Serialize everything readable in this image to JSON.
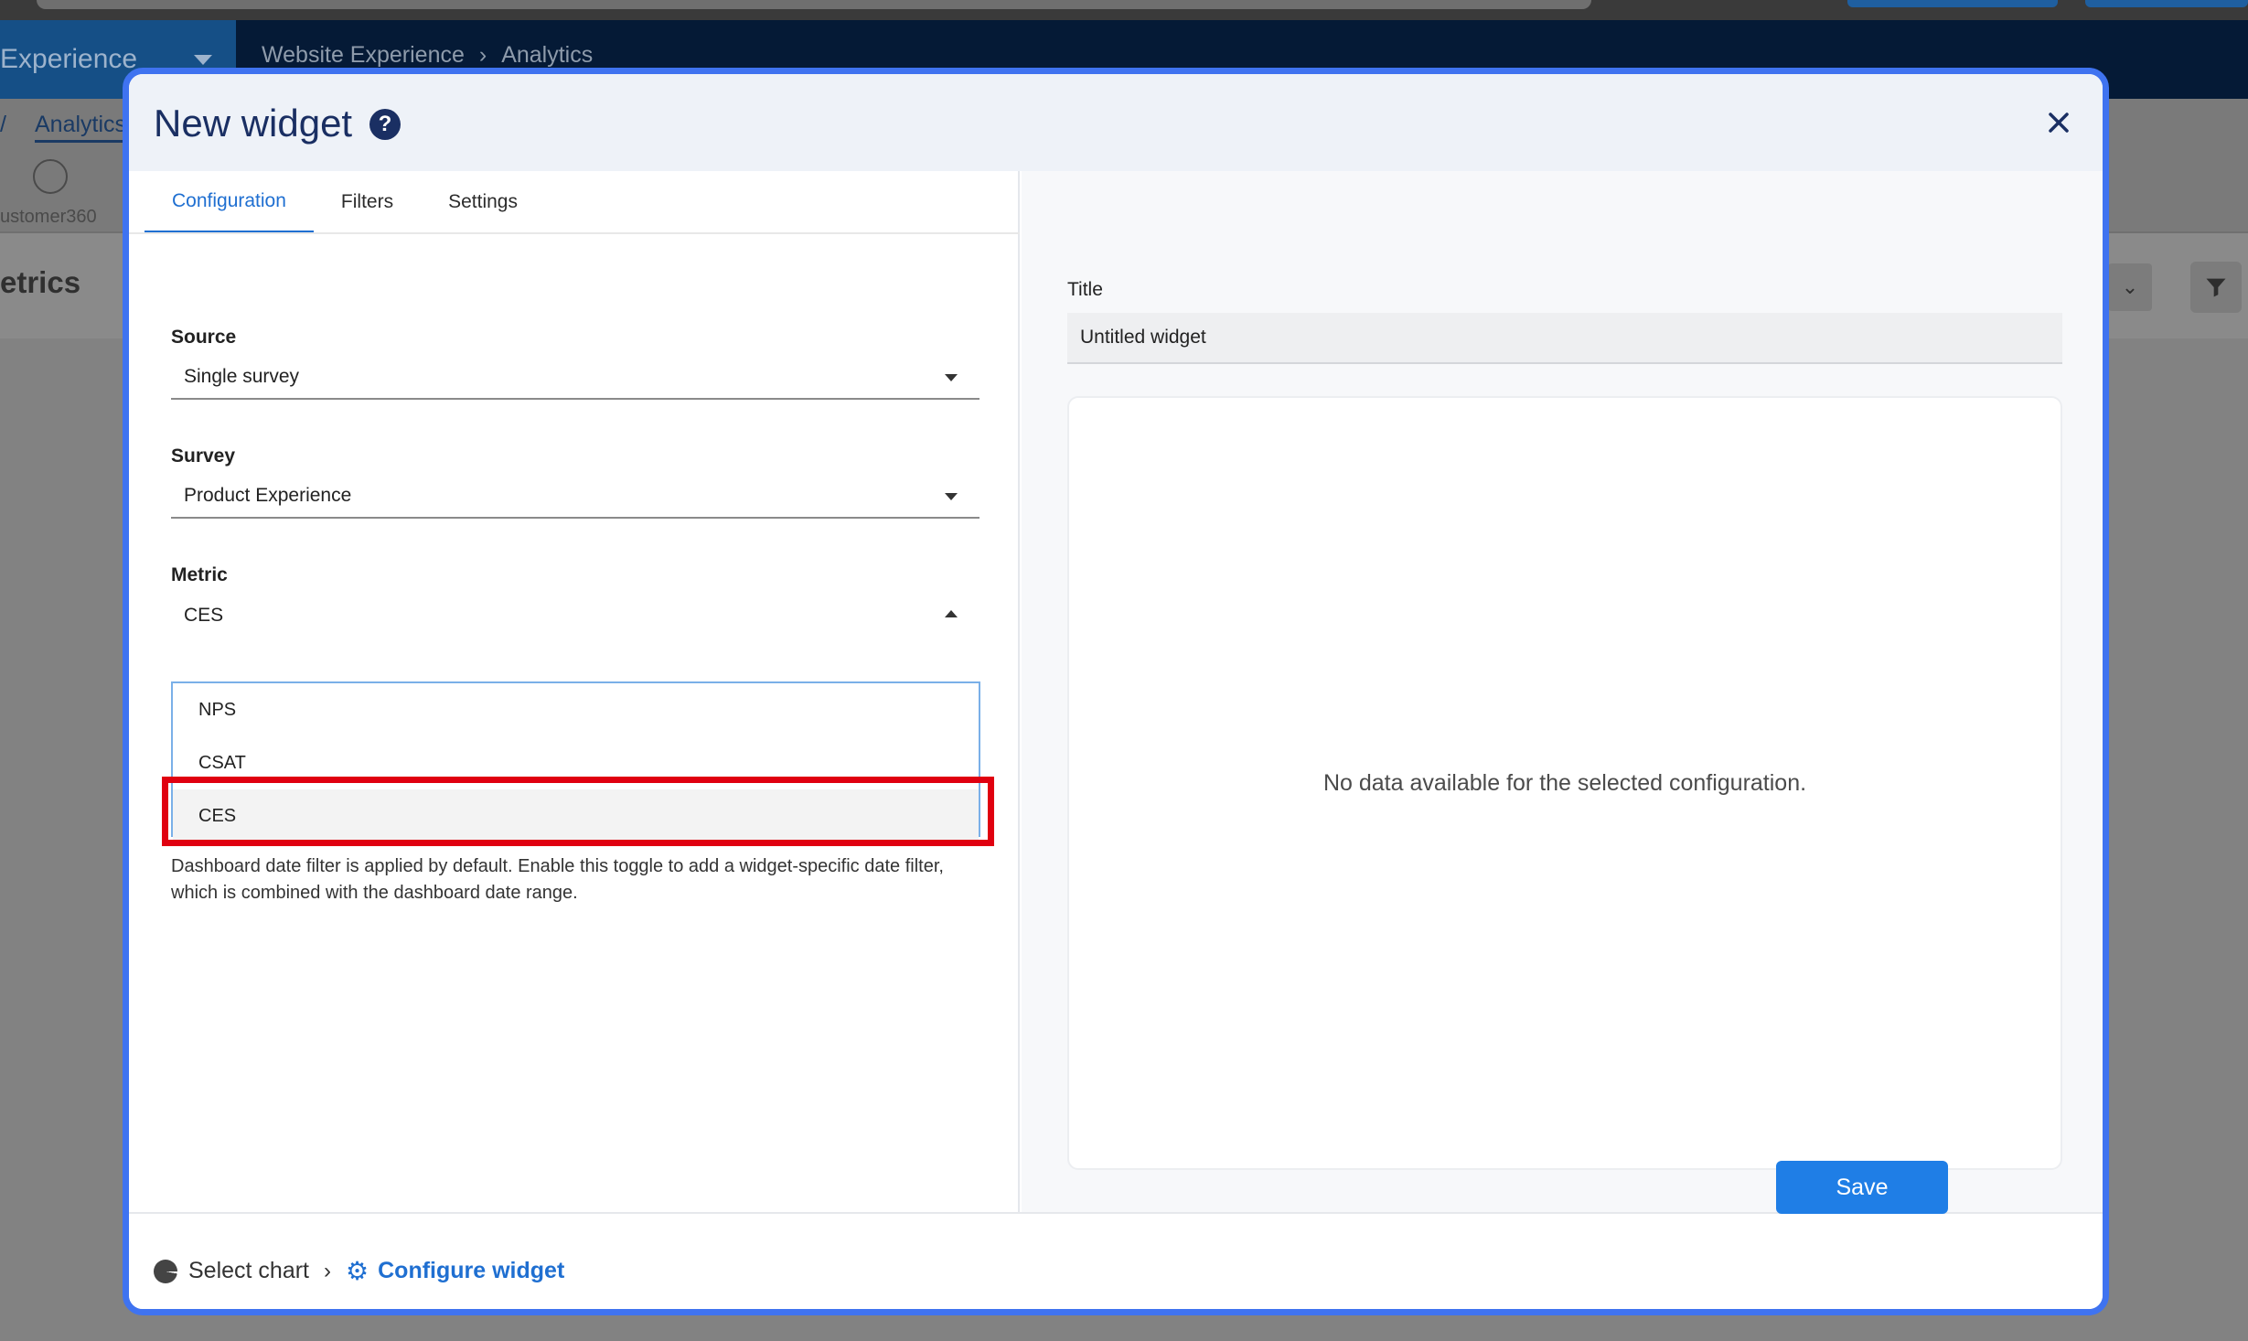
{
  "background": {
    "app_switcher_label": "Experience",
    "breadcrumb": [
      "Website Experience",
      "Analytics"
    ],
    "subnav_tab": "Analytics",
    "subnav_prefix": "/",
    "customer360_label": "ustomer360",
    "page_heading": "etrics",
    "chevron": "⌄"
  },
  "modal": {
    "title": "New widget",
    "help_symbol": "?",
    "tabs": [
      {
        "label": "Configuration",
        "active": true
      },
      {
        "label": "Filters",
        "active": false
      },
      {
        "label": "Settings",
        "active": false
      }
    ],
    "source": {
      "label": "Source",
      "value": "Single survey"
    },
    "survey": {
      "label": "Survey",
      "value": "Product Experience"
    },
    "metric": {
      "label": "Metric",
      "value": "CES",
      "options": [
        "NPS",
        "CSAT",
        "CES"
      ],
      "selected": "CES"
    },
    "date_filter_help": "Dashboard date filter is applied by default. Enable this toggle to add a widget-specific date filter, which is combined with the dashboard date range.",
    "preview": {
      "title_label": "Title",
      "title_value": "Untitled widget",
      "empty_message": "No data available for the selected configuration."
    },
    "footer": {
      "steps": [
        "Select chart",
        "Configure widget"
      ],
      "separator": "›",
      "save_label": "Save"
    }
  },
  "colors": {
    "accent": "#1f7ee6",
    "title": "#1a2f63",
    "highlight": "#e00010",
    "modal_border": "#3f73f0"
  }
}
